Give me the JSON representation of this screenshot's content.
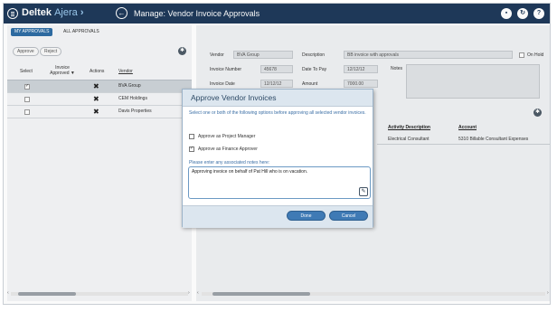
{
  "app": {
    "brand_primary": "Deltek",
    "brand_secondary": "Ajera",
    "page_title": "Manage: Vendor Invoice Approvals"
  },
  "colors": {
    "topbar": "#1f3a5a",
    "accent": "#2e6da4",
    "button": "#3f7ab5"
  },
  "topbar_icons": [
    "save-icon",
    "refresh-icon",
    "help-icon"
  ],
  "left": {
    "tabs": [
      {
        "label": "MY APPROVALS",
        "active": true
      },
      {
        "label": "ALL APPROVALS",
        "active": false
      }
    ],
    "buttons": {
      "approve": "Approve",
      "reject": "Reject"
    },
    "columns": {
      "select": "Select",
      "invoice_approved": "Invoice Approved",
      "actions": "Actions",
      "vendor": "Vendor"
    },
    "rows": [
      {
        "vendor": "BVA Group",
        "checked": true,
        "selected": true
      },
      {
        "vendor": "CEM Holdings",
        "checked": false,
        "selected": false
      },
      {
        "vendor": "Davis Properties",
        "checked": false,
        "selected": false
      }
    ]
  },
  "detail": {
    "vendor_label": "Vendor",
    "vendor_value": "BVA Group",
    "description_label": "Description",
    "description_value": "BB invoice with approvals",
    "on_hold_label": "On Hold",
    "invoice_number_label": "Invoice Number",
    "invoice_number_value": "45678",
    "date_to_pay_label": "Date To Pay",
    "date_to_pay_value": "12/12/12",
    "notes_label": "Notes",
    "invoice_date_label": "Invoice Date",
    "invoice_date_value": "12/12/12",
    "amount_label": "Amount",
    "amount_value": "7000.00",
    "grid_columns": {
      "activity_description": "Activity Description",
      "account": "Account"
    },
    "grid_rows": [
      {
        "activity_description": "Electrical Consultant",
        "account": "5310 Billable Consultant Expenses"
      }
    ]
  },
  "dialog": {
    "title": "Approve Vendor Invoices",
    "intro": "Select one or both of the following options before approving all selected vendor invoices.",
    "options": [
      {
        "label": "Approve as Project Manager",
        "checked": false
      },
      {
        "label": "Approve as Finance Approver",
        "checked": true
      }
    ],
    "notes_label": "Please enter any associated notes here:",
    "notes_value": "Approving invoice on behalf of Pat Hill who is on vacation.",
    "done_label": "Done",
    "cancel_label": "Cancel"
  }
}
